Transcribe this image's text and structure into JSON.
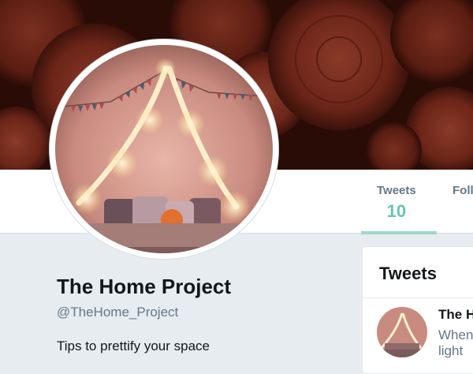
{
  "colors": {
    "accent": "#66c5b5",
    "banner": "#2a0d08",
    "page_background": "#e6ecf0",
    "text_primary": "#14171a",
    "text_secondary": "#657786"
  },
  "banner": {
    "description_icon": "wood-logs-banner"
  },
  "profile": {
    "avatar_icon": "profile-avatar",
    "name": "The Home Project",
    "handle": "@TheHome_Project",
    "bio": "Tips to prettify your space"
  },
  "nav": {
    "items": [
      {
        "label": "Tweets",
        "value": "10",
        "active": true
      },
      {
        "label": "Foll",
        "value": ""
      }
    ]
  },
  "tweets_panel": {
    "title": "Tweets",
    "tweet": {
      "author": "The H",
      "text_line1": "When",
      "text_line2": "light"
    }
  }
}
